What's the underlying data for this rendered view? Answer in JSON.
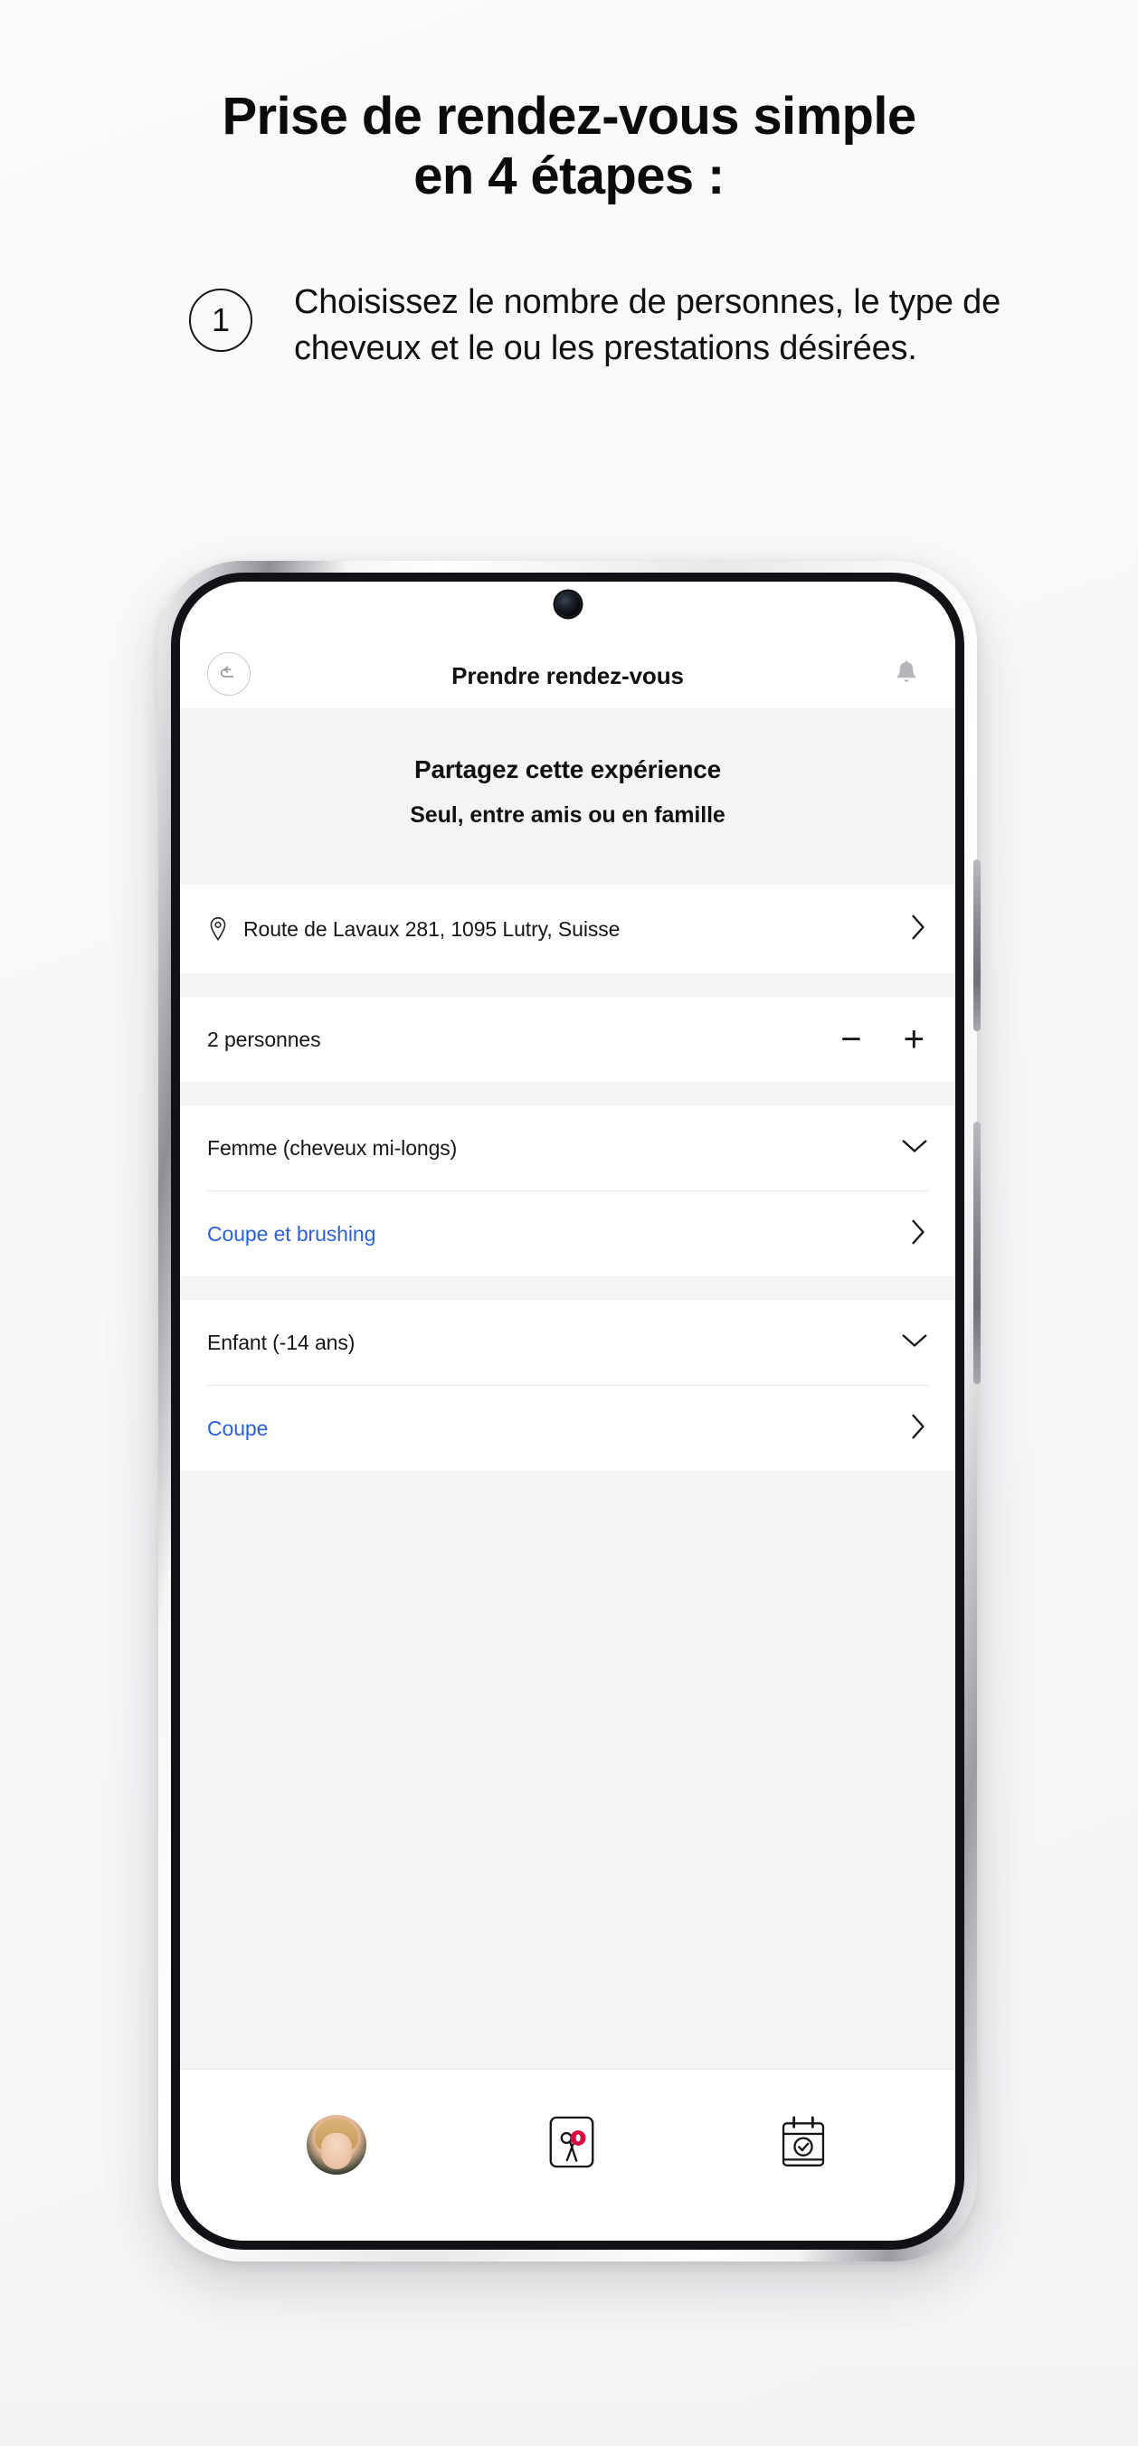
{
  "headline": {
    "line1": "Prise de rendez-vous simple",
    "line2": "en 4 étapes :"
  },
  "step": {
    "number": "1",
    "text": "Choisissez le nombre de personnes, le type de cheveux et le ou les prestations désirées."
  },
  "phone": {
    "header": {
      "back_icon": "back-arrow-circle-icon",
      "title": "Prendre rendez-vous",
      "bell_icon": "bell-icon"
    },
    "banner": {
      "title": "Partagez cette expérience",
      "subtitle": "Seul, entre amis ou en famille"
    },
    "address_row": {
      "icon": "map-pin-icon",
      "label": "Route de Lavaux 281, 1095 Lutry, Suisse",
      "chevron": "chevron-right-icon"
    },
    "people_row": {
      "label": "2 personnes",
      "minus": "−",
      "plus": "+"
    },
    "selections": [
      {
        "type_label": "Femme (cheveux mi-longs)",
        "type_chevron": "chevron-down-icon",
        "service_label": "Coupe et brushing",
        "service_chevron": "chevron-right-icon"
      },
      {
        "type_label": "Enfant (-14 ans)",
        "type_chevron": "chevron-down-icon",
        "service_label": "Coupe",
        "service_chevron": "chevron-right-icon"
      }
    ],
    "bottom_nav": [
      {
        "name": "profile-avatar"
      },
      {
        "name": "salon-card-icon"
      },
      {
        "name": "calendar-check-icon"
      }
    ]
  },
  "colors": {
    "link": "#2b61d6",
    "badge": "#d60b3f",
    "text": "#111114",
    "panel": "#f4f4f6"
  }
}
